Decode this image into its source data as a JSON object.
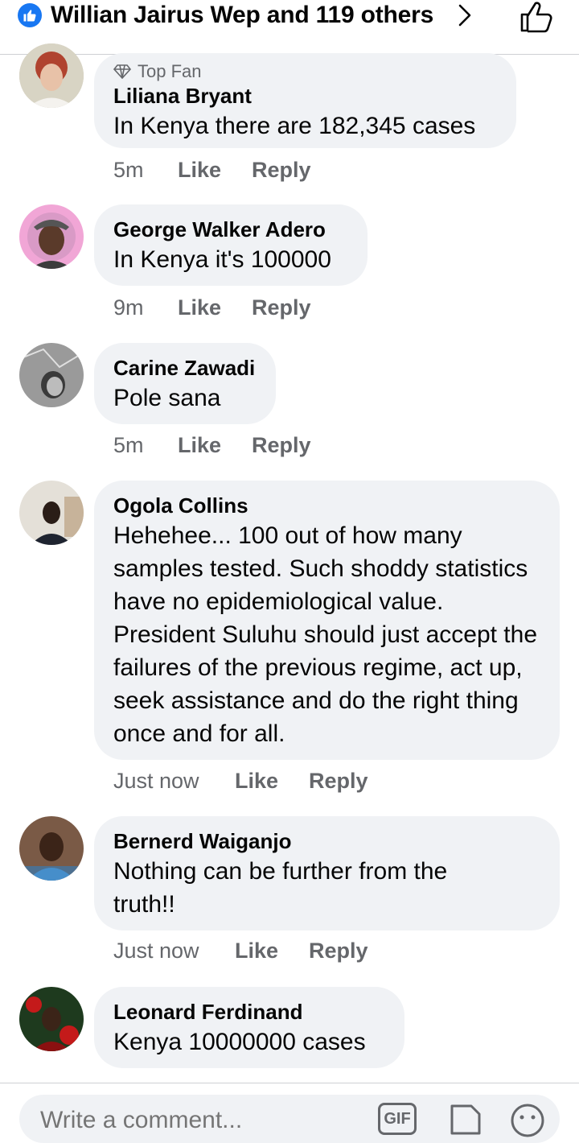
{
  "header": {
    "title": "Willian Jairus Wep and 119 others",
    "like_icon": "thumbs-up-icon",
    "chevron_icon": "chevron-right-icon",
    "like_button_icon": "thumbs-up-outline-icon",
    "accent": "#1877f2"
  },
  "comments": [
    {
      "badge": "Top Fan",
      "author": "Liliana Bryant",
      "text": "In Kenya there are 182,345 cases",
      "time": "5m",
      "like": "Like",
      "reply": "Reply"
    },
    {
      "author": "George Walker Adero",
      "text": "In Kenya it's 100000",
      "time": "9m",
      "like": "Like",
      "reply": "Reply"
    },
    {
      "author": "Carine Zawadi",
      "text": "Pole sana",
      "time": "5m",
      "like": "Like",
      "reply": "Reply"
    },
    {
      "author": "Ogola Collins",
      "text": "Hehehee... 100 out of how many samples tested. Such shoddy statistics have no epidemiological value. President Suluhu should just accept the failures of the previous regime, act up, seek assistance and do the right thing once and for all.",
      "time": "Just now",
      "like": "Like",
      "reply": "Reply"
    },
    {
      "author": "Bernerd Waiganjo",
      "text": "Nothing can be further from the truth!!",
      "time": "Just now",
      "like": "Like",
      "reply": "Reply"
    },
    {
      "author": "Leonard Ferdinand",
      "text": "Kenya 10000000 cases",
      "time": "",
      "like": "",
      "reply": ""
    }
  ],
  "composer": {
    "placeholder": "Write a comment...",
    "gif_label": "GIF"
  }
}
